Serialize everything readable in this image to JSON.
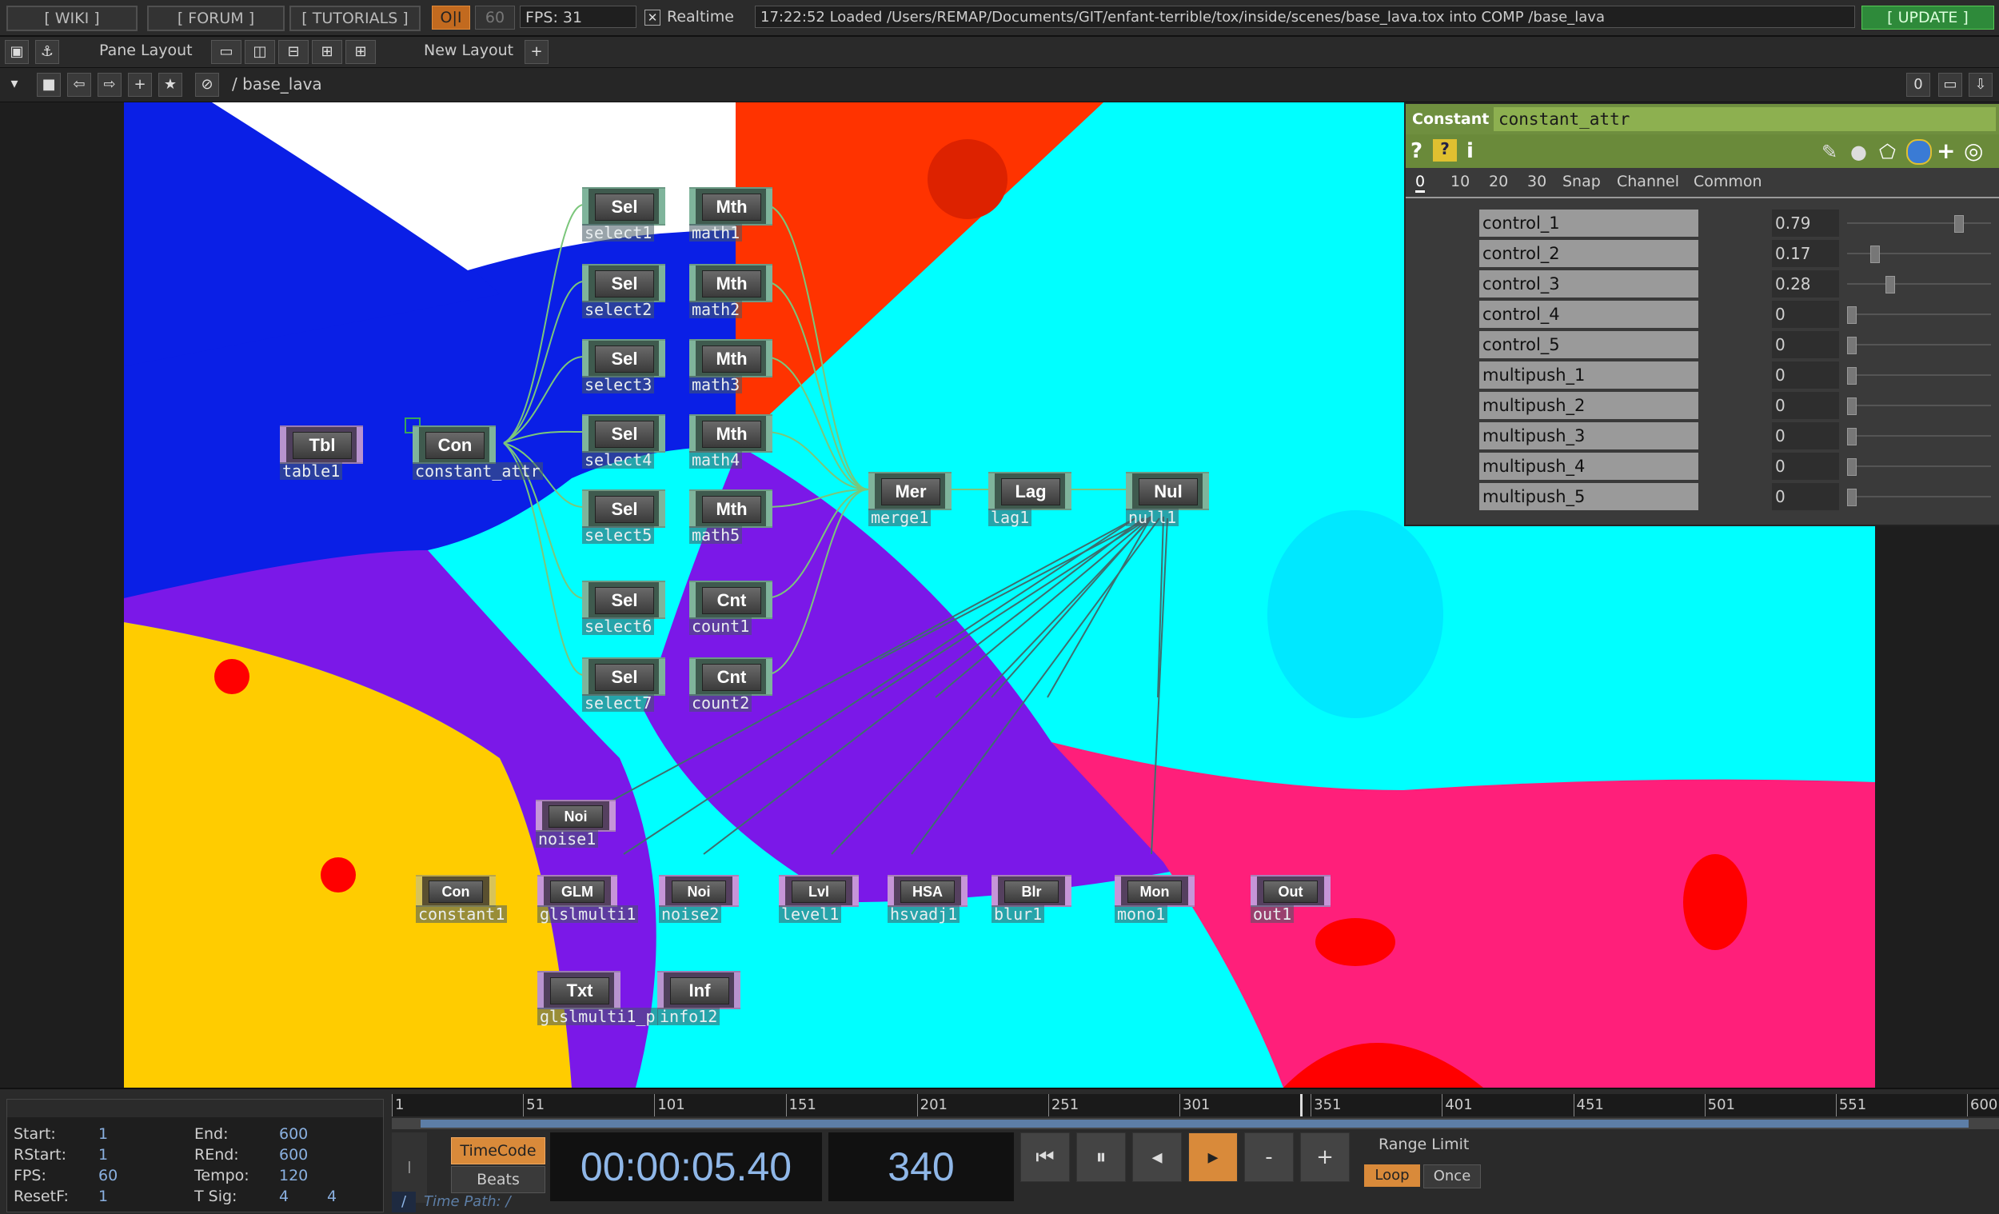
{
  "topbar": {
    "wiki": "[ WIKI ]",
    "forum": "[ FORUM ]",
    "tutorials": "[ TUTORIALS ]",
    "oi": "O|I",
    "sixty": "60",
    "fps_label": "FPS:  31",
    "realtime_label": "Realtime",
    "status": "17:22:52 Loaded /Users/REMAP/Documents/GIT/enfant-terrible/tox/inside/scenes/base_lava.tox into COMP /base_lava",
    "update": "[ UPDATE ]"
  },
  "toolbar2": {
    "pane_layout": "Pane Layout",
    "new_layout": "New Layout",
    "plus": "+"
  },
  "toolbar3": {
    "path": "/ base_lava",
    "right_num": "0"
  },
  "nodes": {
    "tbl": {
      "tile": "Tbl",
      "label": "table1"
    },
    "con": {
      "tile": "Con",
      "label": "constant_attr"
    },
    "sel1": {
      "tile": "Sel",
      "label": "select1"
    },
    "sel2": {
      "tile": "Sel",
      "label": "select2"
    },
    "sel3": {
      "tile": "Sel",
      "label": "select3"
    },
    "sel4": {
      "tile": "Sel",
      "label": "select4"
    },
    "sel5": {
      "tile": "Sel",
      "label": "select5"
    },
    "sel6": {
      "tile": "Sel",
      "label": "select6"
    },
    "sel7": {
      "tile": "Sel",
      "label": "select7"
    },
    "mth1": {
      "tile": "Mth",
      "label": "math1"
    },
    "mth2": {
      "tile": "Mth",
      "label": "math2"
    },
    "mth3": {
      "tile": "Mth",
      "label": "math3"
    },
    "mth4": {
      "tile": "Mth",
      "label": "math4"
    },
    "mth5": {
      "tile": "Mth",
      "label": "math5"
    },
    "cnt1": {
      "tile": "Cnt",
      "label": "count1"
    },
    "cnt2": {
      "tile": "Cnt",
      "label": "count2"
    },
    "mer": {
      "tile": "Mer",
      "label": "merge1"
    },
    "lag": {
      "tile": "Lag",
      "label": "lag1"
    },
    "nul": {
      "tile": "Nul",
      "label": "null1"
    },
    "noi1": {
      "tile": "Noi",
      "label": "noise1"
    },
    "con2": {
      "tile": "Con",
      "label": "constant1"
    },
    "glm": {
      "tile": "GLM",
      "label": "glslmulti1"
    },
    "noi2": {
      "tile": "Noi",
      "label": "noise2"
    },
    "lvl": {
      "tile": "Lvl",
      "label": "level1"
    },
    "hsa": {
      "tile": "HSA",
      "label": "hsvadj1"
    },
    "blr": {
      "tile": "Blr",
      "label": "blur1"
    },
    "mon": {
      "tile": "Mon",
      "label": "mono1"
    },
    "out": {
      "tile": "Out",
      "label": "out1"
    },
    "txt": {
      "tile": "Txt",
      "label": "glslmulti1_p"
    },
    "inf": {
      "tile": "Inf",
      "label": "info12"
    }
  },
  "param": {
    "type": "Constant",
    "name": "constant_attr",
    "tabs": [
      "0",
      "10",
      "20",
      "30",
      "Snap",
      "Channel",
      "Common"
    ],
    "rows": [
      {
        "name": "control_1",
        "value": "0.79",
        "level": 0.79
      },
      {
        "name": "control_2",
        "value": "0.17",
        "level": 0.17
      },
      {
        "name": "control_3",
        "value": "0.28",
        "level": 0.28
      },
      {
        "name": "control_4",
        "value": "0",
        "level": 0
      },
      {
        "name": "control_5",
        "value": "0",
        "level": 0
      },
      {
        "name": "multipush_1",
        "value": "0",
        "level": 0
      },
      {
        "name": "multipush_2",
        "value": "0",
        "level": 0
      },
      {
        "name": "multipush_3",
        "value": "0",
        "level": 0
      },
      {
        "name": "multipush_4",
        "value": "0",
        "level": 0
      },
      {
        "name": "multipush_5",
        "value": "0",
        "level": 0
      }
    ]
  },
  "timeline": {
    "start_label": "Start:",
    "start": "1",
    "end_label": "End:",
    "end": "600",
    "rstart_label": "RStart:",
    "rstart": "1",
    "rend_label": "REnd:",
    "rend": "600",
    "fps_label": "FPS:",
    "fps": "60",
    "tempo_label": "Tempo:",
    "tempo": "120",
    "resetf_label": "ResetF:",
    "resetf": "1",
    "tsig_label": "T Sig:",
    "tsig_a": "4",
    "tsig_b": "4",
    "ticks": [
      "1",
      "51",
      "101",
      "151",
      "201",
      "251",
      "301",
      "351",
      "401",
      "451",
      "501",
      "551",
      "600"
    ],
    "timecode_btn": "TimeCode",
    "beats_btn": "Beats",
    "timecode": "00:00:05.40",
    "frame": "340",
    "range_limit": "Range Limit",
    "loop": "Loop",
    "once": "Once",
    "time_path": "Time Path: /",
    "slash": "/"
  }
}
